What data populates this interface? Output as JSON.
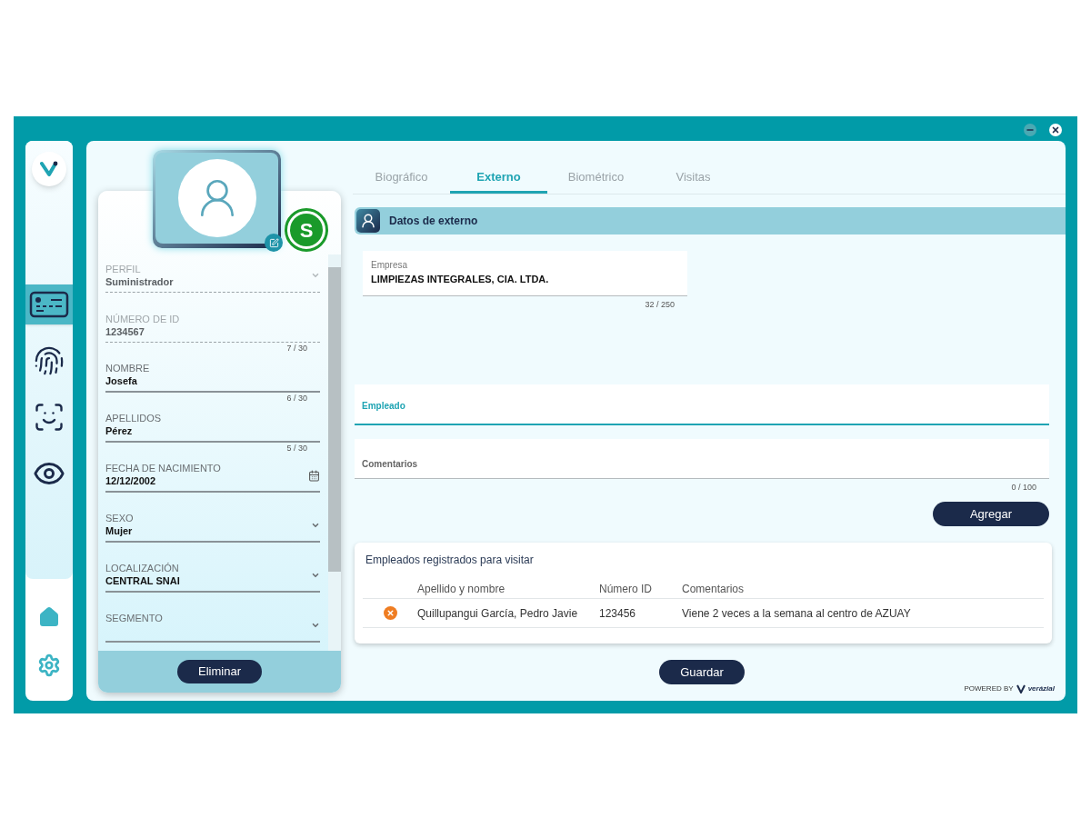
{
  "window_controls": [
    {
      "kind": "minimize"
    },
    {
      "kind": "close"
    }
  ],
  "sidebar": {
    "items": [
      {
        "kind": "id-card",
        "selected": true
      },
      {
        "kind": "fingerprint",
        "selected": false
      },
      {
        "kind": "face-scan",
        "selected": false
      },
      {
        "kind": "eye",
        "selected": false
      }
    ],
    "bottom_items": [
      {
        "kind": "home"
      },
      {
        "kind": "settings"
      }
    ]
  },
  "profile": {
    "badge": "S",
    "fields": [
      {
        "label": "PERFIL",
        "value": "Suministrador",
        "kind": "select",
        "disabled": true
      },
      {
        "label": "NÚMERO DE ID",
        "value": "1234567",
        "kind": "text",
        "disabled": true,
        "counter": "7 / 30"
      },
      {
        "label": "NOMBRE",
        "value": "Josefa",
        "kind": "text",
        "disabled": false,
        "counter": "6 / 30"
      },
      {
        "label": "APELLIDOS",
        "value": "Pérez",
        "kind": "text",
        "disabled": false,
        "counter": "5 / 30"
      },
      {
        "label": "FECHA DE NACIMIENTO",
        "value": "12/12/2002",
        "kind": "date",
        "disabled": false
      },
      {
        "label": "SEXO",
        "value": "Mujer",
        "kind": "select",
        "disabled": false
      },
      {
        "label": "LOCALIZACIÓN",
        "value": "CENTRAL SNAI",
        "kind": "select",
        "disabled": false
      },
      {
        "label": "SEGMENTO",
        "kind": "select",
        "disabled": false
      }
    ],
    "delete_button": "Eliminar"
  },
  "tabs": [
    {
      "label": "Biográfico",
      "selected": false
    },
    {
      "label": "Externo",
      "selected": true
    },
    {
      "label": "Biométrico",
      "selected": false
    },
    {
      "label": "Visitas",
      "selected": false
    }
  ],
  "section_title": "Datos de externo",
  "empresa": {
    "label": "Empresa",
    "value": "LIMPIEZAS INTEGRALES, CIA. LTDA.",
    "counter": "32 / 250"
  },
  "empleado": {
    "label": "Empleado",
    "focused": true
  },
  "comentarios": {
    "label": "Comentarios",
    "counter": "0 / 100"
  },
  "add_button": "Agregar",
  "table": {
    "title": "Empleados registrados para visitar",
    "columns": [
      "Apellido y nombre",
      "Número ID",
      "Comentarios"
    ],
    "rows": [
      {
        "name": "Quillupangui García, Pedro Javie",
        "id": "123456",
        "comment": "Viene 2 veces a la semana al centro de AZUAY"
      }
    ]
  },
  "save_button": "Guardar",
  "footer": {
    "powered_by": "POWERED BY",
    "brand": "verázial"
  }
}
